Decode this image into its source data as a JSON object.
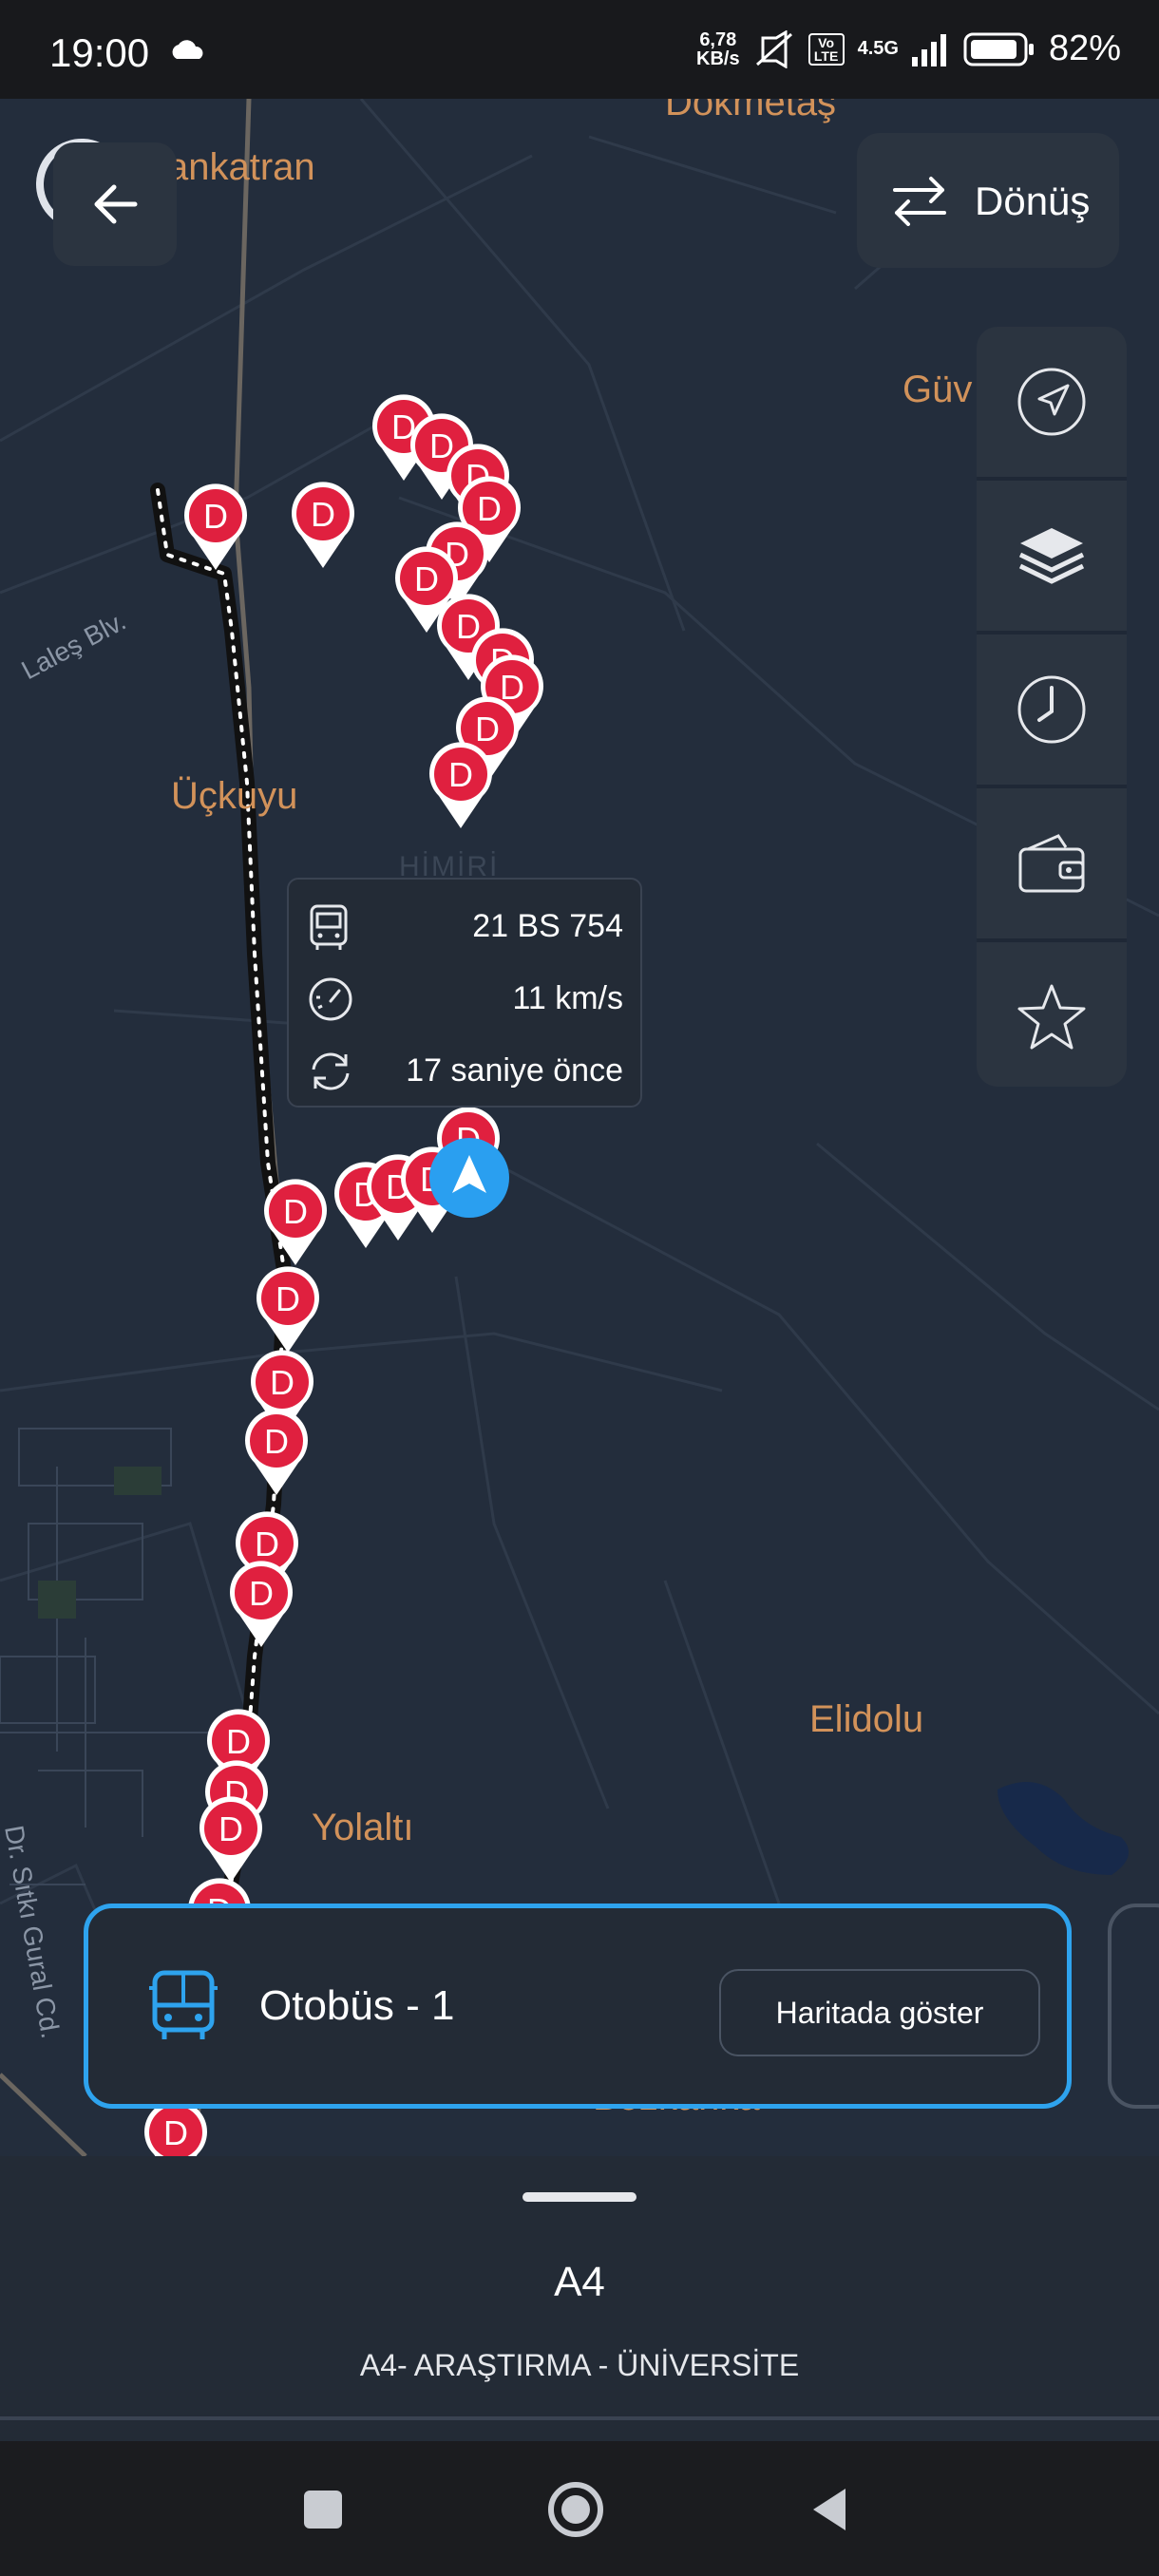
{
  "status_bar": {
    "time": "19:00",
    "net_speed_value": "6,78",
    "net_speed_unit": "KB/s",
    "volte": "Vo LTE",
    "network": "4.5G",
    "battery": "82%",
    "icons": [
      "cloud-icon",
      "mute-icon",
      "signal-icon",
      "battery-icon"
    ]
  },
  "map": {
    "places": {
      "dokmetas": "Dökmetaş",
      "pinarkatran": "ankatran",
      "guv": "Güv",
      "uckuyu": "Üçkuyu",
      "elidolu": "Elidolu",
      "yolalti": "Yolaltı",
      "bottom": "Bozkanka",
      "himiri": "HİMİRİ"
    },
    "streets": {
      "lales": "Laleş Blv.",
      "gural": "Dr. Sıtkı Gural Cd."
    },
    "stop_letter": "D"
  },
  "top_bar": {
    "back_icon": "arrow-left-icon",
    "direction_label": "Dönüş",
    "direction_icon": "swap-arrows-icon"
  },
  "toolbar": [
    "navigate-icon",
    "layers-icon",
    "clock-icon",
    "wallet-icon",
    "star-icon"
  ],
  "vehicle_popup": {
    "plate": "21 BS 754",
    "speed": "11 km/s",
    "updated": "17 saniye önce"
  },
  "bus_card": {
    "title": "Otobüs - 1",
    "button": "Haritada göster"
  },
  "bottom_sheet": {
    "route_code": "A4",
    "route_name": "A4- ARAŞTIRMA - ÜNİVERSİTE"
  },
  "colors": {
    "map_bg": "#232d3c",
    "accent_blue": "#2ea3ee",
    "stop_red": "#e0203f",
    "place_label": "#d2925a"
  }
}
